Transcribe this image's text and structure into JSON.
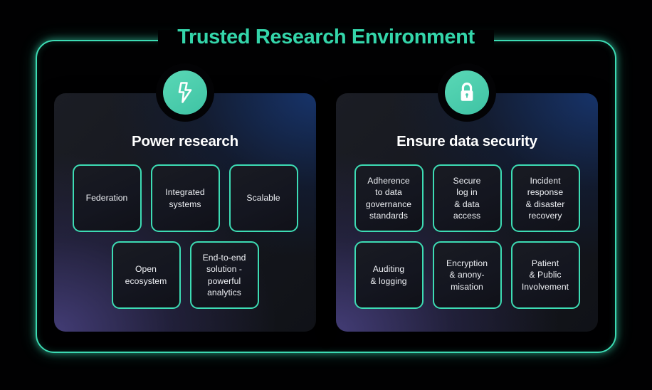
{
  "header": {
    "title": "Trusted Research Environment",
    "title_color": "#34d5aa"
  },
  "theme": {
    "accent": "#3ddcb4",
    "badge_fill": "#45c8ac",
    "panel_navy": "#17356e",
    "panel_purple": "#453e7a",
    "card_bg": "#13141c",
    "page_bg": "#000000",
    "text": "#ffffff"
  },
  "panels": [
    {
      "icon": "lightning-bolt-icon",
      "title": "Power research",
      "rows": [
        [
          {
            "label": "Federation"
          },
          {
            "label": "Integrated\nsystems"
          },
          {
            "label": "Scalable"
          }
        ],
        [
          {
            "label": "Open\necosystem"
          },
          {
            "label": "End-to-end\nsolution -\npowerful\nanalytics"
          }
        ]
      ]
    },
    {
      "icon": "lock-icon",
      "title": "Ensure data security",
      "rows": [
        [
          {
            "label": "Adherence\nto data\ngovernance\nstandards"
          },
          {
            "label": "Secure\nlog in\n& data\naccess"
          },
          {
            "label": "Incident\nresponse\n& disaster\nrecovery"
          }
        ],
        [
          {
            "label": "Auditing\n& logging"
          },
          {
            "label": "Encryption\n& anony-\nmisation"
          },
          {
            "label": "Patient\n& Public\nInvolvement"
          }
        ]
      ]
    }
  ]
}
